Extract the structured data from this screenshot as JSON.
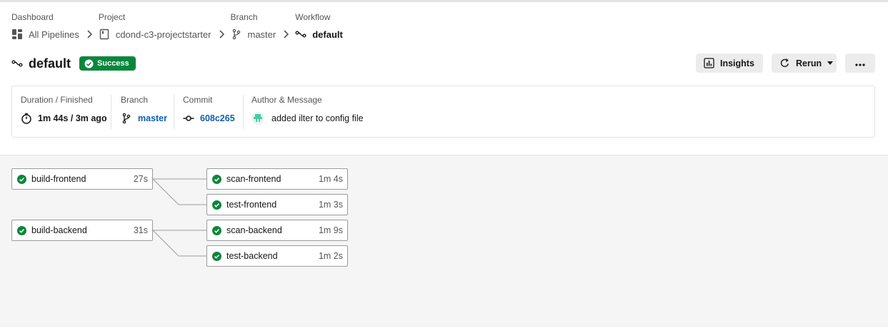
{
  "breadcrumb": {
    "dashboard": {
      "header": "Dashboard",
      "label": "All Pipelines",
      "icon": "pipelines-grid-icon"
    },
    "project": {
      "header": "Project",
      "label": "cdond-c3-projectstarter",
      "icon": "project-book-icon"
    },
    "branch": {
      "header": "Branch",
      "label": "master",
      "icon": "branch-icon"
    },
    "workflow": {
      "header": "Workflow",
      "label": "default",
      "icon": "workflow-icon"
    }
  },
  "workflow": {
    "title": "default",
    "status": "Success",
    "status_color": "#08873a"
  },
  "actions": {
    "insights": "Insights",
    "rerun": "Rerun",
    "more": "…"
  },
  "summary": {
    "duration_label": "Duration / Finished",
    "duration_value": "1m 44s / 3m ago",
    "branch_label": "Branch",
    "branch_value": "master",
    "commit_label": "Commit",
    "commit_value": "608c265",
    "author_label": "Author & Message",
    "author_message": "added ilter to config file"
  },
  "jobs": [
    {
      "name": "build-frontend",
      "duration": "27s",
      "status": "success"
    },
    {
      "name": "scan-frontend",
      "duration": "1m 4s",
      "status": "success"
    },
    {
      "name": "test-frontend",
      "duration": "1m 3s",
      "status": "success"
    },
    {
      "name": "build-backend",
      "duration": "31s",
      "status": "success"
    },
    {
      "name": "scan-backend",
      "duration": "1m 9s",
      "status": "success"
    },
    {
      "name": "test-backend",
      "duration": "1m 2s",
      "status": "success"
    }
  ],
  "colors": {
    "success": "#08873a",
    "link": "#0f5fad",
    "accent_avatar": "#3fd1a6"
  }
}
